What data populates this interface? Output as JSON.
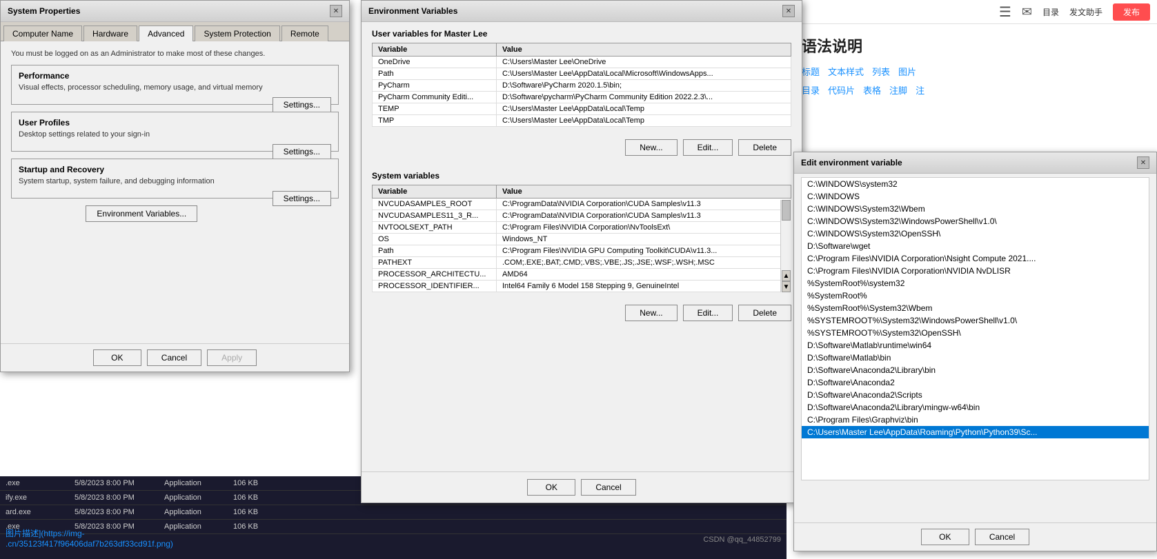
{
  "systemProps": {
    "title": "System Properties",
    "tabs": [
      "Computer Name",
      "Hardware",
      "Advanced",
      "System Protection",
      "Remote"
    ],
    "activeTab": "Advanced",
    "adminNote": "You must be logged on as an Administrator to make most of these changes.",
    "sections": {
      "performance": {
        "label": "Performance",
        "desc": "Visual effects, processor scheduling, memory usage, and virtual memory",
        "btnLabel": "Settings..."
      },
      "userProfiles": {
        "label": "User Profiles",
        "desc": "Desktop settings related to your sign-in",
        "btnLabel": "Settings..."
      },
      "startupRecovery": {
        "label": "Startup and Recovery",
        "desc": "System startup, system failure, and debugging information",
        "btnLabel": "Settings..."
      }
    },
    "envVarsBtn": "Environment Variables...",
    "footer": {
      "ok": "OK",
      "cancel": "Cancel",
      "apply": "Apply"
    }
  },
  "envVars": {
    "title": "Environment Variables",
    "userSection": "User variables for Master Lee",
    "userVarsHeaders": [
      "Variable",
      "Value"
    ],
    "userVars": [
      {
        "var": "OneDrive",
        "value": "C:\\Users\\Master Lee\\OneDrive"
      },
      {
        "var": "Path",
        "value": "C:\\Users\\Master Lee\\AppData\\Local\\Microsoft\\WindowsApps..."
      },
      {
        "var": "PyCharm",
        "value": "D:\\Software\\PyCharm 2020.1.5\\bin;"
      },
      {
        "var": "PyCharm Community Editi...",
        "value": "D:\\Software\\pycharm\\PyCharm Community Edition 2022.2.3\\..."
      },
      {
        "var": "TEMP",
        "value": "C:\\Users\\Master Lee\\AppData\\Local\\Temp"
      },
      {
        "var": "TMP",
        "value": "C:\\Users\\Master Lee\\AppData\\Local\\Temp"
      }
    ],
    "userButtons": {
      "new": "New...",
      "edit": "Edit...",
      "delete": "Delete"
    },
    "sysSection": "System variables",
    "sysVarsHeaders": [
      "Variable",
      "Value"
    ],
    "sysVars": [
      {
        "var": "NVCUDASAMPLES_ROOT",
        "value": "C:\\ProgramData\\NVIDIA Corporation\\CUDA Samples\\v11.3"
      },
      {
        "var": "NVCUDASAMPLES11_3_R...",
        "value": "C:\\ProgramData\\NVIDIA Corporation\\CUDA Samples\\v11.3"
      },
      {
        "var": "NVTOOLSEXT_PATH",
        "value": "C:\\Program Files\\NVIDIA Corporation\\NvToolsExt\\"
      },
      {
        "var": "OS",
        "value": "Windows_NT"
      },
      {
        "var": "Path",
        "value": "C:\\Program Files\\NVIDIA GPU Computing Toolkit\\CUDA\\v11.3..."
      },
      {
        "var": "PATHEXT",
        "value": ".COM;.EXE;.BAT;.CMD;.VBS;.VBE;.JS;.JSE;.WSF;.WSH;.MSC"
      },
      {
        "var": "PROCESSOR_ARCHITECTU...",
        "value": "AMD64"
      },
      {
        "var": "PROCESSOR_IDENTIFIER...",
        "value": "Intel64 Family 6 Model 158 Stepping 9, GenuineIntel"
      }
    ],
    "sysButtons": {
      "new": "New...",
      "edit": "Edit...",
      "delete": "Delete"
    },
    "footer": {
      "ok": "OK",
      "cancel": "Cancel"
    }
  },
  "editEnvVar": {
    "title": "Edit environment variable",
    "items": [
      "C:\\WINDOWS\\system32",
      "C:\\WINDOWS",
      "C:\\WINDOWS\\System32\\Wbem",
      "C:\\WINDOWS\\System32\\WindowsPowerShell\\v1.0\\",
      "C:\\WINDOWS\\System32\\OpenSSH\\",
      "D:\\Software\\wget",
      "C:\\Program Files\\NVIDIA Corporation\\Nsight Compute 2021....",
      "C:\\Program Files\\NVIDIA Corporation\\NVIDIA NvDLISR",
      "%SystemRoot%\\system32",
      "%SystemRoot%",
      "%SystemRoot%\\System32\\Wbem",
      "%SYSTEMROOT%\\System32\\WindowsPowerShell\\v1.0\\",
      "%SYSTEMROOT%\\System32\\OpenSSH\\",
      "D:\\Software\\Matlab\\runtime\\win64",
      "D:\\Software\\Matlab\\bin",
      "D:\\Software\\Anaconda2\\Library\\bin",
      "D:\\Software\\Anaconda2",
      "D:\\Software\\Anaconda2\\Scripts",
      "D:\\Software\\Anaconda2\\Library\\mingw-w64\\bin",
      "C:\\Program Files\\Graphviz\\bin",
      "C:\\Users\\Master Lee\\AppData\\Roaming\\Python\\Python39\\Sc..."
    ],
    "selectedIndex": 20,
    "footer": {
      "ok": "OK",
      "cancel": "Cancel"
    }
  },
  "rightPanel": {
    "icons": [
      "≡",
      "✉"
    ],
    "labels": [
      "目录",
      "发文助手"
    ],
    "redBtnLabel": "发布",
    "grammarTitle": "语法说明",
    "grammarNav1": [
      "标题",
      "文本样式",
      "列表",
      "图片"
    ],
    "grammarNav2": [
      "目录",
      "代码片",
      "表格",
      "注脚",
      "注"
    ]
  },
  "bottomBar": {
    "rows": [
      {
        "name": ".exe",
        "date": "5/8/2023 8:00 PM",
        "type": "Application",
        "size": "106 KB"
      },
      {
        "name": "ify.exe",
        "date": "5/8/2023 8:00 PM",
        "type": "Application",
        "size": "106 KB"
      },
      {
        "name": "ard.exe",
        "date": "5/8/2023 8:00 PM",
        "type": "Application",
        "size": "106 KB"
      },
      {
        "name": ".exe",
        "date": "5/8/2023 8:00 PM",
        "type": "Application",
        "size": "106 KB"
      }
    ],
    "watermark": "CSDN @qq_44852799",
    "linkText": "图片描述](https://img-\n.cn/35123f417f96406daf7b263df33cd91f.png)"
  }
}
